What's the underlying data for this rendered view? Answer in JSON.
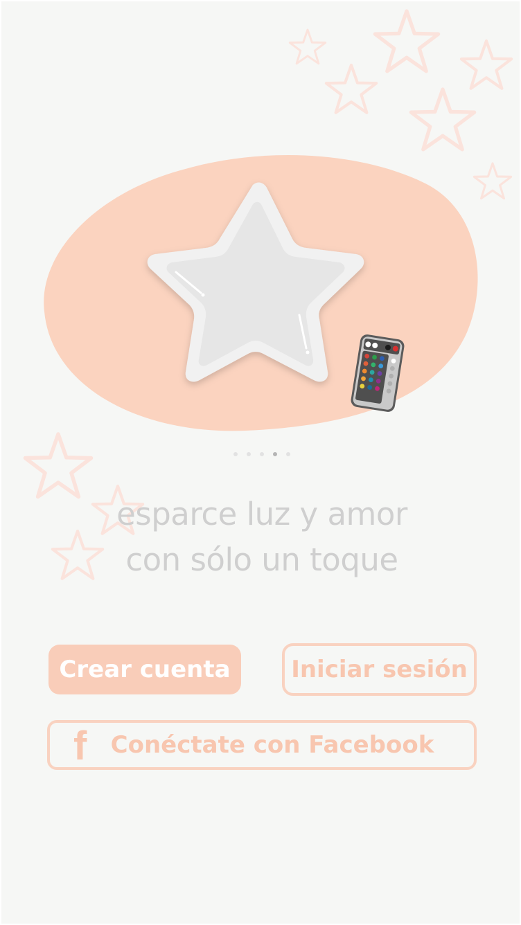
{
  "carousel": {
    "page_count": 5,
    "active_index": 3
  },
  "tagline": {
    "line1": "esparce luz y amor",
    "line2": "con sólo un toque"
  },
  "buttons": {
    "create_account": "Crear cuenta",
    "login": "Iniciar sesión",
    "facebook": "Conéctate con Facebook",
    "facebook_icon_glyph": "f"
  },
  "icons": {
    "hero": "star-lamp-icon",
    "remote": "remote-control-icon",
    "facebook": "facebook-icon",
    "decoration": "star-outline-icon"
  },
  "colors": {
    "background": "#f6f7f5",
    "accent": "#f9cdb9",
    "accent_text": "#f8c6af",
    "tagline": "#cfcfcf",
    "decor_star": "#fbe3dc"
  }
}
